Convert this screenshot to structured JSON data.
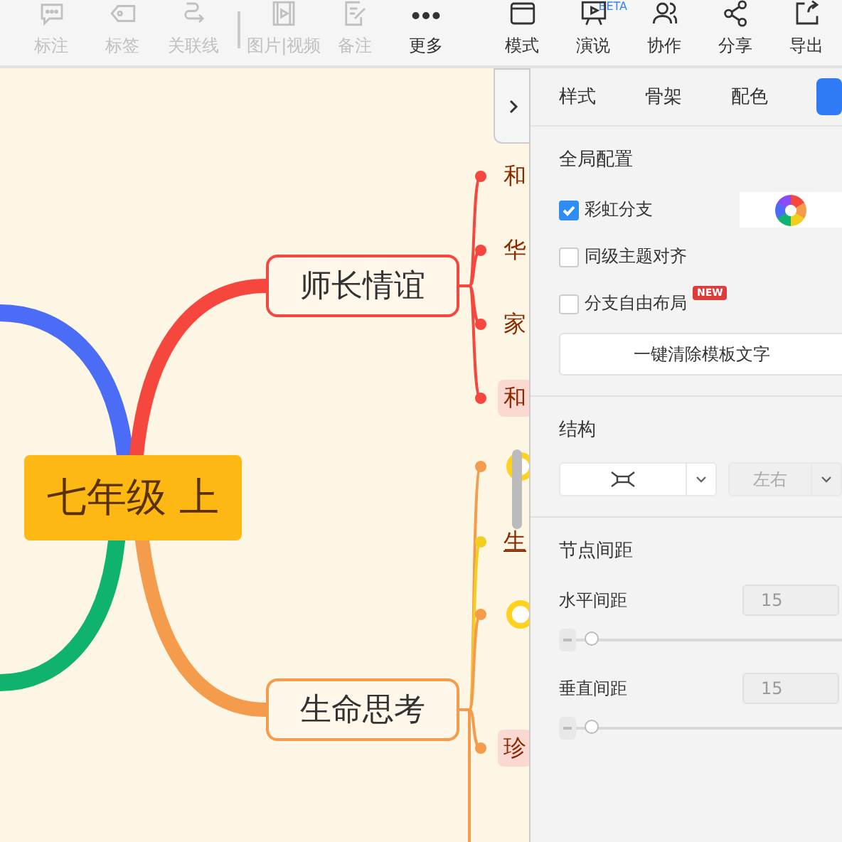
{
  "toolbar": {
    "items": [
      {
        "kind": "tool",
        "label": "标注",
        "disabled": true
      },
      {
        "kind": "tool",
        "label": "标签",
        "disabled": true
      },
      {
        "kind": "tool",
        "label": "关联线",
        "disabled": true
      },
      {
        "kind": "separator"
      },
      {
        "kind": "tool",
        "label": "图片|视频",
        "disabled": true
      },
      {
        "kind": "tool",
        "label": "备注",
        "disabled": true
      },
      {
        "kind": "tool",
        "label": "更多",
        "disabled": false
      },
      {
        "kind": "tool",
        "label": "模式",
        "disabled": false
      },
      {
        "kind": "tool",
        "label": "演说",
        "disabled": false,
        "badge": "BETA"
      },
      {
        "kind": "tool",
        "label": "协作",
        "disabled": false
      },
      {
        "kind": "tool",
        "label": "分享",
        "disabled": false
      },
      {
        "kind": "tool",
        "label": "导出",
        "disabled": false
      }
    ]
  },
  "mindmap": {
    "root": "七年级 上",
    "branches": [
      {
        "color": "#4a6cf7"
      },
      {
        "color": "#10b36e"
      },
      {
        "label": "师长情谊",
        "color": "#f5473d",
        "leaves": [
          {
            "kind": "text",
            "text": "和",
            "highlighted": false,
            "underlined": false,
            "color": "#f5473d"
          },
          {
            "kind": "text",
            "text": "华",
            "highlighted": false,
            "underlined": false,
            "color": "#f5473d"
          },
          {
            "kind": "text",
            "text": "家",
            "highlighted": false,
            "underlined": false,
            "color": "#f5473d"
          },
          {
            "kind": "text",
            "text": "和",
            "highlighted": true,
            "underlined": false,
            "color": "#f5473d"
          }
        ]
      },
      {
        "label": "生命思考",
        "color": "#f59b4c",
        "leaves": [
          {
            "kind": "icon",
            "color": "#f59b4c"
          },
          {
            "kind": "text",
            "text": "生",
            "highlighted": false,
            "underlined": true,
            "color": "#f2cf1f"
          },
          {
            "kind": "icon",
            "color": "#f59b4c"
          },
          {
            "kind": "text",
            "text": "珍",
            "highlighted": true,
            "underlined": false,
            "color": "#f59b4c"
          }
        ]
      }
    ]
  },
  "panel": {
    "tabs": [
      {
        "label": "样式",
        "selected": false
      },
      {
        "label": "骨架",
        "selected": false
      },
      {
        "label": "配色",
        "selected": false
      },
      {
        "selected": true
      }
    ],
    "global": {
      "heading": "全局配置",
      "options": [
        {
          "kind": "swatch",
          "label": "彩虹分支",
          "checked": true
        },
        {
          "kind": "plain",
          "label": "同级主题对齐",
          "checked": false
        },
        {
          "kind": "plain",
          "label": "分支自由布局",
          "checked": false,
          "badge": "NEW"
        }
      ],
      "clear_button": "一键清除模板文字"
    },
    "structure": {
      "heading": "结构",
      "direction_select": {
        "value": "左右",
        "disabled": true
      }
    },
    "spacing": {
      "heading": "节点间距",
      "rows": [
        {
          "label": "水平间距",
          "value": "15",
          "level": 0.03
        },
        {
          "label": "垂直间距",
          "value": "15",
          "level": 0.03
        }
      ]
    }
  }
}
